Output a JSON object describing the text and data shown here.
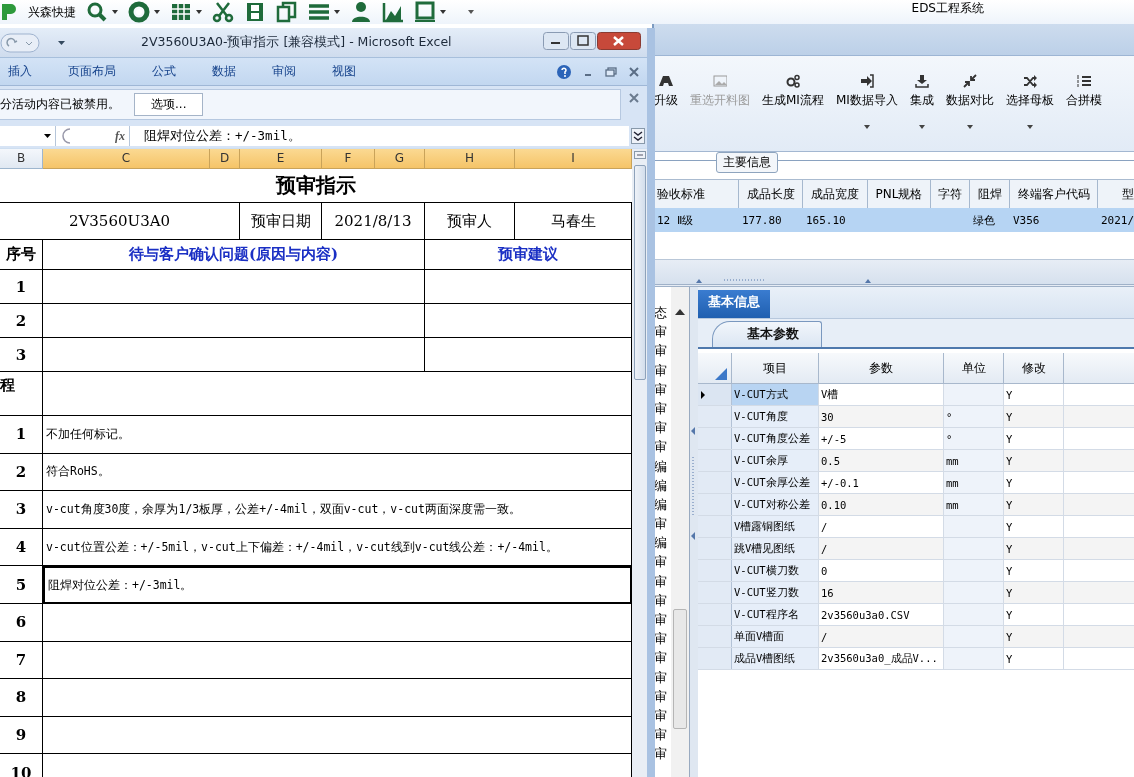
{
  "app": {
    "brand": "兴森快捷",
    "title": "EDS工程系统",
    "ribbon": [
      {
        "label": "升级",
        "disabled": false,
        "dropdown": false
      },
      {
        "label": "重选开料图",
        "disabled": true,
        "dropdown": false
      },
      {
        "label": "生成MI流程",
        "disabled": false,
        "dropdown": false
      },
      {
        "label": "MI数据导入",
        "disabled": false,
        "dropdown": true
      },
      {
        "label": "集成",
        "disabled": false,
        "dropdown": true
      },
      {
        "label": "数据对比",
        "disabled": false,
        "dropdown": true
      },
      {
        "label": "选择母板",
        "disabled": false,
        "dropdown": true
      },
      {
        "label": "合拼模",
        "disabled": false,
        "dropdown": false
      }
    ],
    "main_info": {
      "title": "主要信息",
      "columns": [
        "验收标准",
        "成品长度",
        "成品宽度",
        "PNL规格",
        "字符",
        "阻焊",
        "终端客户代码",
        "型"
      ],
      "rows": [
        {
          "selected": true,
          "cells": [
            "12 Ⅱ级",
            "177.80",
            "165.10",
            null,
            null,
            "绿色",
            "V356",
            "2021/"
          ]
        }
      ]
    },
    "status_list": {
      "header": "态",
      "items": [
        "审",
        "审",
        "审",
        "审",
        "审",
        "审",
        "审",
        "编",
        "编",
        "编",
        "审",
        "编",
        "审",
        "审",
        "审",
        "审",
        "审",
        "审",
        "审",
        "审",
        "审",
        "审",
        "审"
      ]
    },
    "tabs": [
      {
        "label": "基本信息",
        "selected": true
      }
    ],
    "subtabs": [
      {
        "label": "基本参数",
        "selected": true
      }
    ],
    "params": {
      "columns": [
        "项目",
        "参数",
        "单位",
        "修改"
      ],
      "rows": [
        {
          "selected": true,
          "cells": [
            "V-CUT方式",
            "V槽",
            null,
            "Y"
          ]
        },
        {
          "selected": false,
          "cells": [
            "V-CUT角度",
            "30",
            "°",
            "Y"
          ]
        },
        {
          "selected": false,
          "cells": [
            "V-CUT角度公差",
            "+/-5",
            "°",
            "Y"
          ]
        },
        {
          "selected": false,
          "cells": [
            "V-CUT余厚",
            "0.5",
            "mm",
            "Y"
          ]
        },
        {
          "selected": false,
          "cells": [
            "V-CUT余厚公差",
            "+/-0.1",
            "mm",
            "Y"
          ]
        },
        {
          "selected": false,
          "cells": [
            "V-CUT对称公差",
            "0.10",
            "mm",
            "Y"
          ]
        },
        {
          "selected": false,
          "cells": [
            "V槽露铜图纸",
            "/",
            null,
            "Y"
          ]
        },
        {
          "selected": false,
          "cells": [
            "跳V槽见图纸",
            "/",
            null,
            "Y"
          ]
        },
        {
          "selected": false,
          "cells": [
            "V-CUT横刀数",
            "0",
            null,
            "Y"
          ]
        },
        {
          "selected": false,
          "cells": [
            "V-CUT竖刀数",
            "16",
            null,
            "Y"
          ]
        },
        {
          "selected": false,
          "cells": [
            "V-CUT程序名",
            "2v3560u3a0.CSV",
            null,
            "Y"
          ]
        },
        {
          "selected": false,
          "cells": [
            "单面V槽面",
            "/",
            null,
            "Y"
          ]
        },
        {
          "selected": false,
          "cells": [
            "成品V槽图纸",
            "2v3560u3a0_成品V...",
            null,
            "Y"
          ]
        }
      ]
    }
  },
  "excel": {
    "title": "2V3560U3A0-预审指示  [兼容模式] - Microsoft Excel",
    "tabs": [
      "插入",
      "页面布局",
      "公式",
      "数据",
      "审阅",
      "视图"
    ],
    "message": {
      "text": "分活动内容已被禁用。",
      "button": "选项..."
    },
    "formula": {
      "fx": "fx",
      "value": "阻焊对位公差：+/-3mil。"
    },
    "columns": [
      {
        "label": "B",
        "selected": false
      },
      {
        "label": "C",
        "selected": true
      },
      {
        "label": "D",
        "selected": true
      },
      {
        "label": "E",
        "selected": true
      },
      {
        "label": "F",
        "selected": true
      },
      {
        "label": "G",
        "selected": true
      },
      {
        "label": "H",
        "selected": true
      },
      {
        "label": "I",
        "selected": true
      }
    ],
    "rows": [
      {
        "kind": "title",
        "text": "预审指示"
      },
      {
        "kind": "info",
        "cells": [
          "2V3560U3A0",
          "预审日期",
          "2021/8/13",
          "预审人",
          "马春生"
        ]
      },
      {
        "kind": "header",
        "cells": [
          "序号",
          "待与客户确认问题(原因与内容)",
          "预审建议"
        ]
      },
      {
        "kind": "question",
        "number": "1"
      },
      {
        "kind": "question",
        "number": "2"
      },
      {
        "kind": "question",
        "number": "3"
      },
      {
        "kind": "section",
        "label": "程"
      },
      {
        "kind": "item",
        "number": "1",
        "text": "不加任何标记。"
      },
      {
        "kind": "item",
        "number": "2",
        "text": "符合RoHS。"
      },
      {
        "kind": "item",
        "number": "3",
        "text": "v-cut角度30度，余厚为1/3板厚，公差+/-4mil，双面v-cut，v-cut两面深度需一致。"
      },
      {
        "kind": "item",
        "number": "4",
        "text": "v-cut位置公差：+/-5mil，v-cut上下偏差：+/-4mil，v-cut线到v-cut线公差：+/-4mil。"
      },
      {
        "kind": "item",
        "number": "5",
        "text": "阻焊对位公差：+/-3mil。",
        "selected": true
      },
      {
        "kind": "item",
        "number": "6"
      },
      {
        "kind": "item",
        "number": "7"
      },
      {
        "kind": "item",
        "number": "8"
      },
      {
        "kind": "item",
        "number": "9"
      },
      {
        "kind": "item",
        "number": "10"
      }
    ]
  }
}
